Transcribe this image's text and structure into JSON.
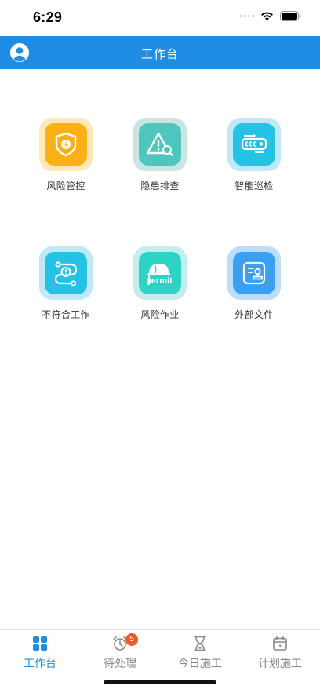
{
  "status": {
    "time": "6:29"
  },
  "header": {
    "title": "工作台"
  },
  "tiles": [
    {
      "label": "风险管控",
      "icon": "shield-lightning-icon",
      "color": "#fbb116"
    },
    {
      "label": "隐患排查",
      "icon": "warning-search-icon",
      "color": "#4fc6bd"
    },
    {
      "label": "智能巡检",
      "icon": "inspection-device-icon",
      "color": "#24c3e6"
    },
    {
      "label": "不符合工作",
      "icon": "path-alert-icon",
      "color": "#24c3e6"
    },
    {
      "label": "风险作业",
      "icon": "permit-helmet-icon",
      "color": "#2dd3c5"
    },
    {
      "label": "外部文件",
      "icon": "document-stamp-icon",
      "color": "#3aa0f3"
    }
  ],
  "tabbar": {
    "items": [
      {
        "label": "工作台",
        "icon": "grid-icon",
        "active": true
      },
      {
        "label": "待处理",
        "icon": "alarm-clock-icon",
        "badge": "5"
      },
      {
        "label": "今日施工",
        "icon": "hourglass-icon"
      },
      {
        "label": "计划施工",
        "icon": "calendar-icon"
      }
    ]
  },
  "colors": {
    "primary": "#1f8de3",
    "badge": "#f05a24"
  }
}
